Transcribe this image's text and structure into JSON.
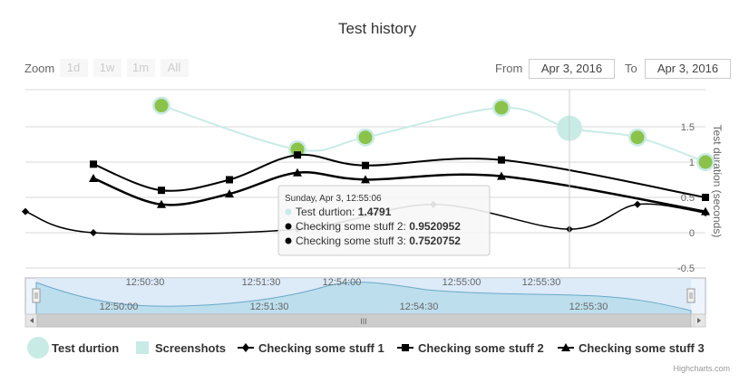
{
  "title": "Test history",
  "zoom": {
    "label": "Zoom",
    "buttons": [
      "1d",
      "1w",
      "1m",
      "All"
    ]
  },
  "range": {
    "from_label": "From",
    "from_value": "Apr 3, 2016",
    "to_label": "To",
    "to_value": "Apr 3, 2016"
  },
  "credits": "Highcharts.com",
  "navigator": {
    "top_labels": [
      "12:50:30",
      "12:51:30",
      "12:54:00",
      "12:55:00",
      "12:55:30"
    ],
    "bottom_labels": [
      "12:50:00",
      "12:51:30",
      "12:54:30",
      "12:55:30"
    ],
    "scroll_grip": "III"
  },
  "tooltip": {
    "header": "Sunday, Apr 3, 12:55:06",
    "rows": [
      {
        "label": "Test durtion: ",
        "value": "1.4791"
      },
      {
        "label": "Checking some stuff 2: ",
        "value": "0.9520952"
      },
      {
        "label": "Checking some stuff 3: ",
        "value": "0.7520752"
      }
    ]
  },
  "colors": {
    "series1": "#8bc34a",
    "series1_line": "#c9ebe6",
    "black": "#000000",
    "navigator_fill": "#b5dbe8",
    "crosshair": "#cccccc"
  },
  "chart_data": {
    "type": "line",
    "y_axis": {
      "label": "Test duration (seconds)",
      "ticks": [
        "1.5",
        "1",
        "0.5",
        "0",
        "-0.5"
      ],
      "tick_values": [
        1.5,
        1,
        0.5,
        0,
        -0.5
      ],
      "position": "right"
    },
    "grid": true,
    "legend_placement": "bottom",
    "crosshair_index": 6,
    "series": [
      {
        "name": "Test durtion",
        "marker": "circle",
        "values": [
          null,
          null,
          1.8,
          null,
          1.18,
          1.35,
          null,
          1.77,
          1.4791,
          1.35,
          1.0
        ]
      },
      {
        "name": "Checking some stuff 1",
        "marker": "diamond",
        "values": [
          0.3,
          0.0,
          null,
          null,
          0.05,
          null,
          0.4,
          null,
          0.05,
          0.4,
          0.28
        ]
      },
      {
        "name": "Checking some stuff 2",
        "marker": "square",
        "values": [
          null,
          0.97,
          0.6,
          0.75,
          1.1,
          0.9520952,
          null,
          1.03,
          null,
          null,
          0.5
        ]
      },
      {
        "name": "Checking some stuff 3",
        "marker": "triangle",
        "values": [
          null,
          0.77,
          0.4,
          0.55,
          0.85,
          0.7520752,
          null,
          0.8,
          null,
          null,
          0.3
        ]
      }
    ],
    "legend": [
      "Test durtion",
      "Screenshots",
      "Checking some stuff 1",
      "Checking some stuff 2",
      "Checking some stuff 3"
    ]
  }
}
